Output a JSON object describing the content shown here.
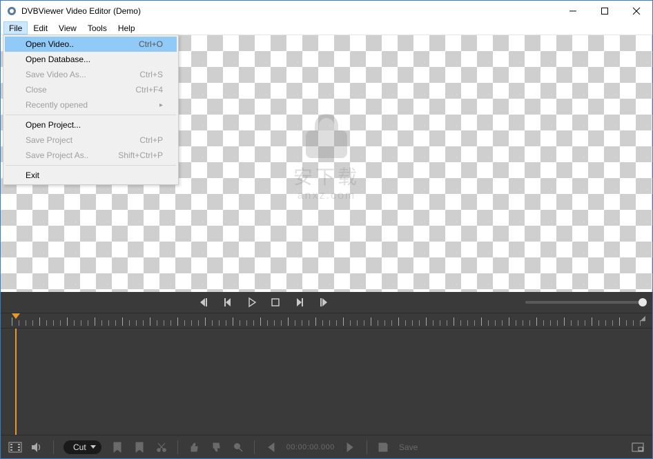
{
  "title": "DVBViewer Video Editor (Demo)",
  "menubar": [
    "File",
    "Edit",
    "View",
    "Tools",
    "Help"
  ],
  "file_menu": {
    "open_video": {
      "label": "Open Video..",
      "shortcut": "Ctrl+O"
    },
    "open_database": {
      "label": "Open Database...",
      "shortcut": ""
    },
    "save_video_as": {
      "label": "Save Video As...",
      "shortcut": "Ctrl+S"
    },
    "close": {
      "label": "Close",
      "shortcut": "Ctrl+F4"
    },
    "recently_opened": {
      "label": "Recently opened",
      "shortcut": ""
    },
    "open_project": {
      "label": "Open Project...",
      "shortcut": ""
    },
    "save_project": {
      "label": "Save Project",
      "shortcut": "Ctrl+P"
    },
    "save_project_as": {
      "label": "Save Project As..",
      "shortcut": "Shift+Ctrl+P"
    },
    "exit": {
      "label": "Exit",
      "shortcut": ""
    }
  },
  "watermark": {
    "cn": "安下载",
    "domain": "anxz.com"
  },
  "bottombar": {
    "cut_label": "Cut",
    "timecode": "00:00:00.000",
    "save_label": "Save"
  }
}
